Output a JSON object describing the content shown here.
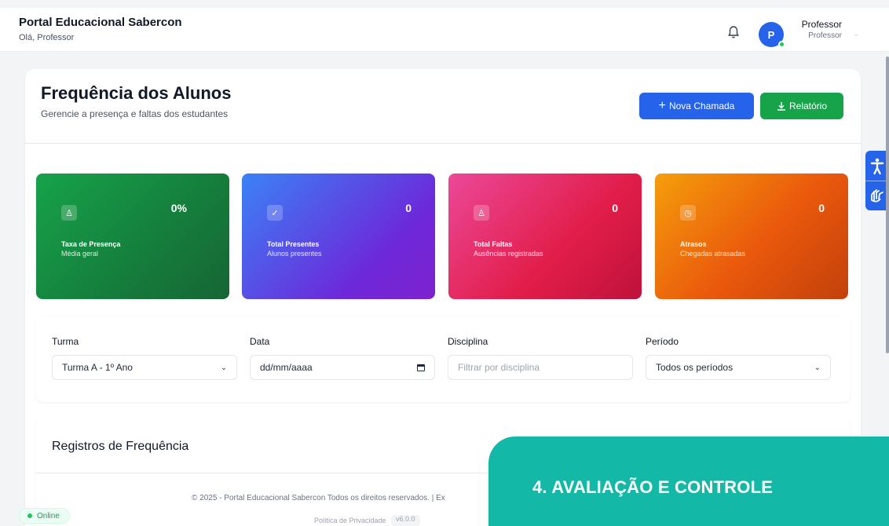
{
  "header": {
    "app_title": "Portal Educacional Sabercon",
    "greeting": "Olá, Professor",
    "user": {
      "initial": "P",
      "name": "Professor",
      "role": "Professor"
    }
  },
  "page": {
    "title": "Frequência dos Alunos",
    "subtitle": "Gerencie a presença e faltas dos estudantes",
    "new_call_button": "Nova Chamada",
    "report_button": "Relatório"
  },
  "stats": [
    {
      "value": "0%",
      "label": "Taxa de Presença",
      "sub": "Média geral",
      "icon": "user-check-icon"
    },
    {
      "value": "0",
      "label": "Total Presentes",
      "sub": "Alunos presentes",
      "icon": "check-circle-icon"
    },
    {
      "value": "0",
      "label": "Total Faltas",
      "sub": "Ausências registradas",
      "icon": "user-x-icon"
    },
    {
      "value": "0",
      "label": "Atrasos",
      "sub": "Chegadas atrasadas",
      "icon": "clock-icon"
    }
  ],
  "filters": {
    "turma": {
      "label": "Turma",
      "value": "Turma A - 1º Ano"
    },
    "data": {
      "label": "Data",
      "placeholder": "dd/mm/aaaa"
    },
    "disciplina": {
      "label": "Disciplina",
      "placeholder": "Filtrar por disciplina"
    },
    "periodo": {
      "label": "Período",
      "value": "Todos os períodos"
    }
  },
  "records": {
    "title": "Registros de Frequência"
  },
  "footer": {
    "copyright": "© 2025 - Portal Educacional Sabercon Todos os direitos reservados. | Ex",
    "privacy": "Política de Privacidade",
    "version": "v6.0.0"
  },
  "status": {
    "online": "Online"
  },
  "overlay": {
    "text": "4.   AVALIAÇÃO E CONTROLE"
  },
  "colors": {
    "primary": "#2563eb",
    "success": "#16a34a",
    "overlay": "#14b8a6"
  }
}
